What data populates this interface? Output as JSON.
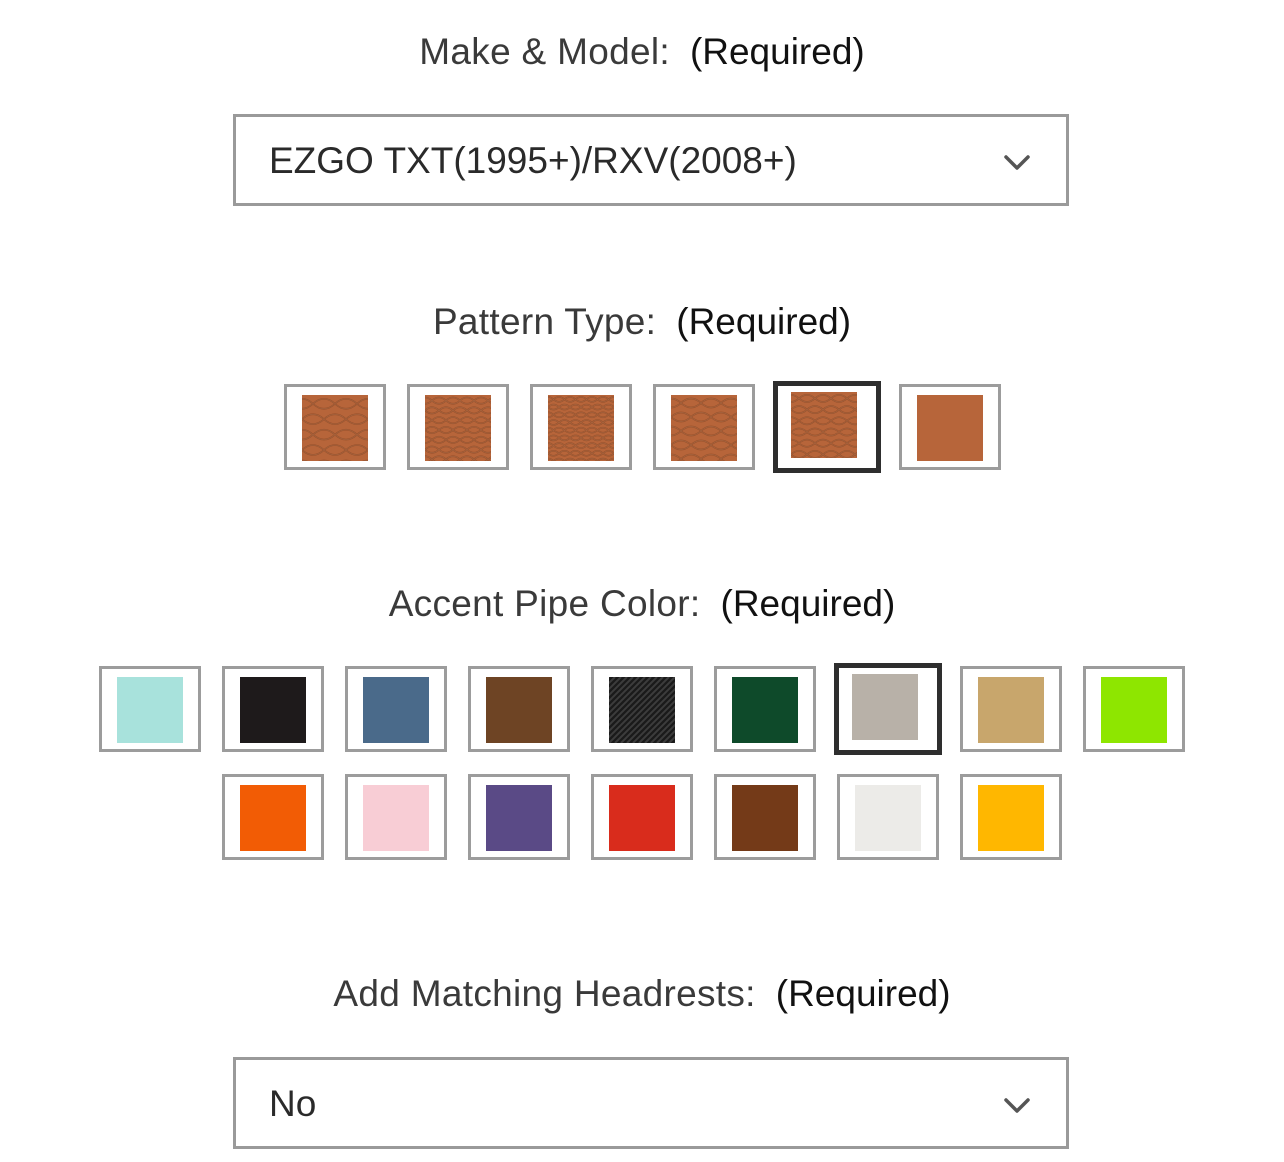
{
  "make_model": {
    "label": "Make & Model:",
    "required": "(Required)",
    "selected": "EZGO TXT(1995+)/RXV(2008+)",
    "icon": "chevron-down-icon"
  },
  "pattern_type": {
    "label": "Pattern Type:",
    "required": "(Required)",
    "base_color": "#b7653a",
    "selected_index": 4,
    "options": [
      {
        "name": "pattern-1",
        "style": "snake-large"
      },
      {
        "name": "pattern-2",
        "style": "snake-scale"
      },
      {
        "name": "pattern-3",
        "style": "snake-fine"
      },
      {
        "name": "pattern-4",
        "style": "snake-diamond"
      },
      {
        "name": "pattern-5",
        "style": "snake-wave"
      },
      {
        "name": "pattern-6",
        "style": "smooth"
      }
    ]
  },
  "accent_pipe_color": {
    "label": "Accent Pipe Color:",
    "required": "(Required)",
    "selected_index": 6,
    "options": [
      {
        "name": "aqua",
        "color": "#a8e2dc"
      },
      {
        "name": "black",
        "color": "#1e1a1b"
      },
      {
        "name": "blue-gray",
        "color": "#4a6a8a"
      },
      {
        "name": "brown",
        "color": "#6e4424"
      },
      {
        "name": "carbon-fiber",
        "color": "#1a1a1a"
      },
      {
        "name": "dark-green",
        "color": "#0e4a2a"
      },
      {
        "name": "gray",
        "color": "#b8b1a8"
      },
      {
        "name": "tan",
        "color": "#c8a66c"
      },
      {
        "name": "lime",
        "color": "#8ee600"
      },
      {
        "name": "orange",
        "color": "#f25c05"
      },
      {
        "name": "pink",
        "color": "#f8cdd5"
      },
      {
        "name": "purple",
        "color": "#5a4a86"
      },
      {
        "name": "red",
        "color": "#d92c1c"
      },
      {
        "name": "chestnut",
        "color": "#743a18"
      },
      {
        "name": "white",
        "color": "#ecebe8"
      },
      {
        "name": "yellow",
        "color": "#ffb700"
      }
    ]
  },
  "headrests": {
    "label": "Add Matching Headrests:",
    "required": "(Required)",
    "selected": "No",
    "icon": "chevron-down-icon"
  }
}
